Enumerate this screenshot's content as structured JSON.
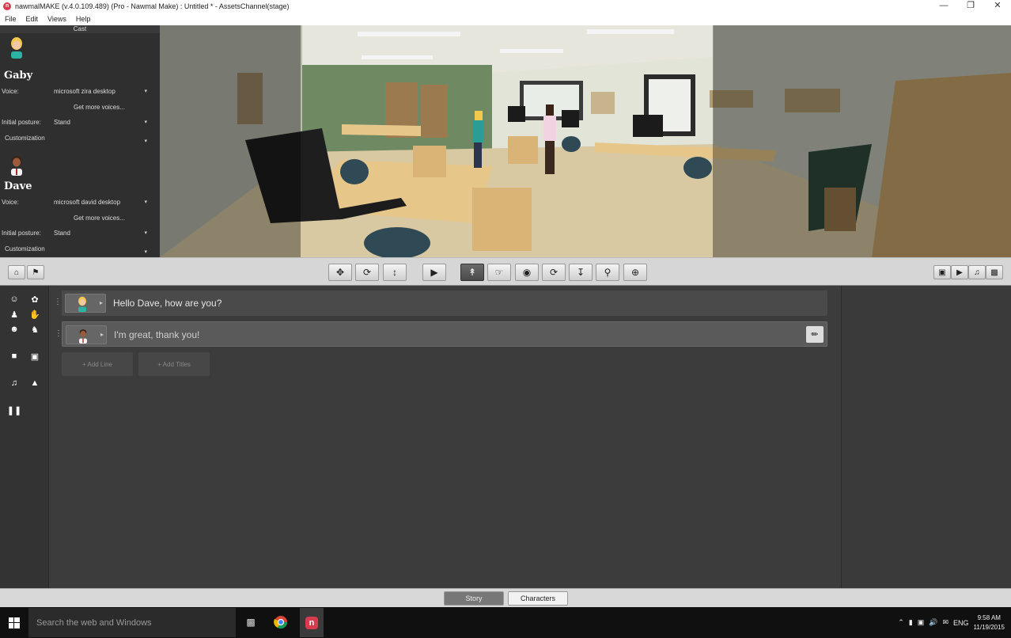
{
  "window": {
    "title": "nawmalMAKE (v.4.0.109.489) (Pro - Nawmal Make) : Untitled * - AssetsChannel(stage)",
    "icon": "nawmal-app-icon",
    "controls": [
      "minimize",
      "restore",
      "close"
    ]
  },
  "menu": [
    "File",
    "Edit",
    "Views",
    "Help"
  ],
  "cast": {
    "title": "Cast",
    "characters": [
      {
        "name": "Gaby",
        "voice_label": "Voice:",
        "voice": "microsoft zira desktop",
        "more_voices": "Get more voices...",
        "posture_label": "Initial posture:",
        "posture": "Stand",
        "customization": "Customization"
      },
      {
        "name": "Dave",
        "voice_label": "Voice:",
        "voice": "microsoft david desktop",
        "more_voices": "Get more voices...",
        "posture_label": "Initial posture:",
        "posture": "Stand",
        "customization": "Customization"
      }
    ]
  },
  "toolbar": {
    "left": [
      "home-icon",
      "group-icon"
    ],
    "camera": [
      "move-icon",
      "rotate-icon",
      "height-icon"
    ],
    "play": "play-icon",
    "view": [
      "pick-icon",
      "hand-icon",
      "eye-icon",
      "refresh-icon",
      "align-icon",
      "zoom-icon",
      "zoom-fit-icon"
    ],
    "right": [
      "camera-icon",
      "video-icon",
      "music-icon",
      "image-icon"
    ]
  },
  "script": {
    "lines": [
      {
        "speaker": "Gaby",
        "text": "Hello Dave, how are you?"
      },
      {
        "speaker": "Dave",
        "text": "I'm great, thank you!"
      }
    ],
    "add_line": "+ Add Line",
    "add_titles": "+ Add Titles"
  },
  "tabs": {
    "story": "Story",
    "characters": "Characters",
    "active": "Story"
  },
  "taskbar": {
    "search_placeholder": "Search the web and Windows",
    "language": "ENG",
    "time": "9:58 AM",
    "date": "11/19/2015"
  },
  "colors": {
    "accent": "#d93b4e",
    "panel": "#2f2f2f",
    "toolbar": "#d6d6d6"
  }
}
